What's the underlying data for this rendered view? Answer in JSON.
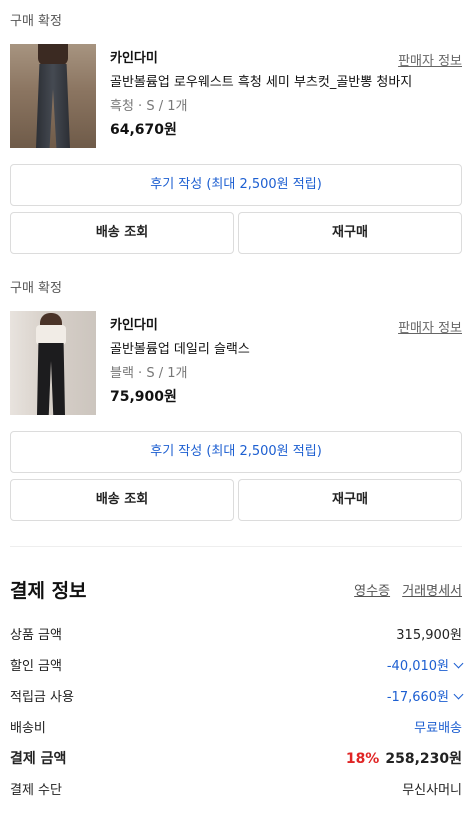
{
  "orders": [
    {
      "status": "구매 확정",
      "brand": "카인다미",
      "seller_link": "판매자 정보",
      "product_name": "골반볼륨업 로우웨스트 흑청 세미 부츠컷_골반뽕 청바지",
      "option": "흑청 · S / 1개",
      "price": "64,670원",
      "review_button": "후기 작성 (최대 2,500원 적립)",
      "shipping_button": "배송 조회",
      "rebuy_button": "재구매"
    },
    {
      "status": "구매 확정",
      "brand": "카인다미",
      "seller_link": "판매자 정보",
      "product_name": "골반볼륨업 데일리 슬랙스",
      "option": "블랙 · S / 1개",
      "price": "75,900원",
      "review_button": "후기 작성 (최대 2,500원 적립)",
      "shipping_button": "배송 조회",
      "rebuy_button": "재구매"
    }
  ],
  "payment": {
    "title": "결제 정보",
    "receipt_link": "영수증",
    "statement_link": "거래명세서",
    "rows": {
      "product_amount": {
        "label": "상품 금액",
        "value": "315,900원"
      },
      "discount": {
        "label": "할인 금액",
        "value": "-40,010원"
      },
      "points": {
        "label": "적립금 사용",
        "value": "-17,660원"
      },
      "shipping": {
        "label": "배송비",
        "value": "무료배송"
      },
      "total": {
        "label": "결제 금액",
        "percent": "18%",
        "value": "258,230원"
      },
      "method": {
        "label": "결제 수단",
        "value": "무신사머니"
      }
    }
  },
  "colors": {
    "accent_blue": "#1d5fd1",
    "discount_red": "#e02525"
  }
}
